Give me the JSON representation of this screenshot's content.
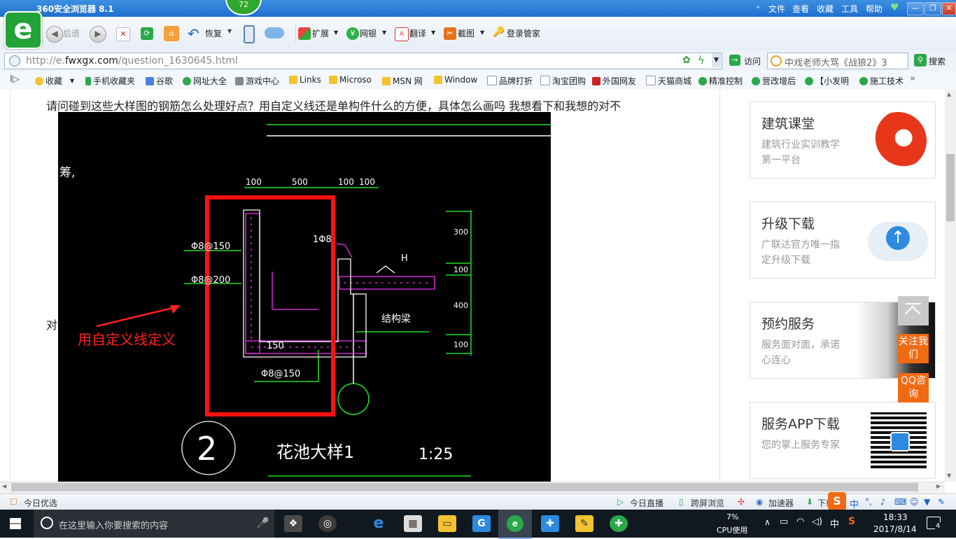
{
  "window": {
    "title": "360安全浏览器 8.1",
    "badge": "72",
    "menu": [
      "文件",
      "查看",
      "收藏",
      "工具",
      "帮助"
    ],
    "controls": [
      "—",
      "❐",
      "✕"
    ]
  },
  "toolbar": {
    "back_label": "后退",
    "restore_label": "恢复",
    "extensions_label": "扩展",
    "netbank_label": "网银",
    "translate_label": "翻译",
    "screenshot_label": "截图",
    "login_manager_label": "登录管家"
  },
  "address_bar": {
    "url_prefix": "http://e.",
    "url_domain": "fwxgx.com",
    "url_path": "/question_1630645.html",
    "visit_label": "访问",
    "search_value": "中戏老师大骂《战狼2》3",
    "search_label": "搜索"
  },
  "favorites": [
    "收藏",
    "手机收藏夹",
    "谷歌",
    "网址大全",
    "游戏中心",
    "Links",
    "Microso",
    "MSN 网",
    "Window",
    "品牌打折",
    "淘宝团购",
    "外国网友",
    "天猫商城",
    "精准控制",
    "营改增后",
    "【小发明",
    "施工技术"
  ],
  "content": {
    "question": "请问碰到这些大样图的钢筋怎么处理好点？用自定义线还是单构件什么的方便，具体怎么画吗 我想看下和我想的对不",
    "side_text": "对",
    "drawing": {
      "annotation": "用自定义线定义",
      "dims_top": [
        "100",
        "500",
        "100",
        "100"
      ],
      "rebar_labels": [
        "Φ8@150",
        "Φ8@200",
        "1Φ8",
        "Φ8@150",
        "150"
      ],
      "side_dims": [
        "300",
        "100",
        "400",
        "100"
      ],
      "h_label": "H",
      "beam_label": "结构梁",
      "title": "花池大样1",
      "scale": "1:25",
      "detail_no": "2",
      "left_char": "筹,"
    }
  },
  "sidebar": [
    {
      "title": "建筑课堂",
      "subtitle": "建筑行业实训教学第一平台"
    },
    {
      "title": "升级下载",
      "subtitle": "广联达官方唯一指定升级下载"
    },
    {
      "title": "预约服务",
      "subtitle": "服务面对面，承诺心连心"
    },
    {
      "title": "服务APP下载",
      "subtitle": "您的掌上服务专家"
    }
  ],
  "float_buttons": {
    "follow": "关注我们",
    "qq": "QQ咨询"
  },
  "statusbar": {
    "left": "今日优选",
    "live": "今日直播",
    "cross_screen": "跨屏浏览",
    "accelerator": "加速器",
    "download": "下载",
    "ime": "中"
  },
  "taskbar": {
    "search_placeholder": "在这里输入你要搜索的内容",
    "cpu_percent": "7%",
    "cpu_label": "CPU使用",
    "ime": "中",
    "time": "18:33",
    "date": "2017/8/14",
    "notifications": "4"
  },
  "colors": {
    "title_blue": "#1f6fd0",
    "logo_green": "#21a338",
    "orange": "#f06a14",
    "cad_magenta": "#d02ad0",
    "cad_green": "#22dd22",
    "annotation_red": "#ff2020"
  }
}
